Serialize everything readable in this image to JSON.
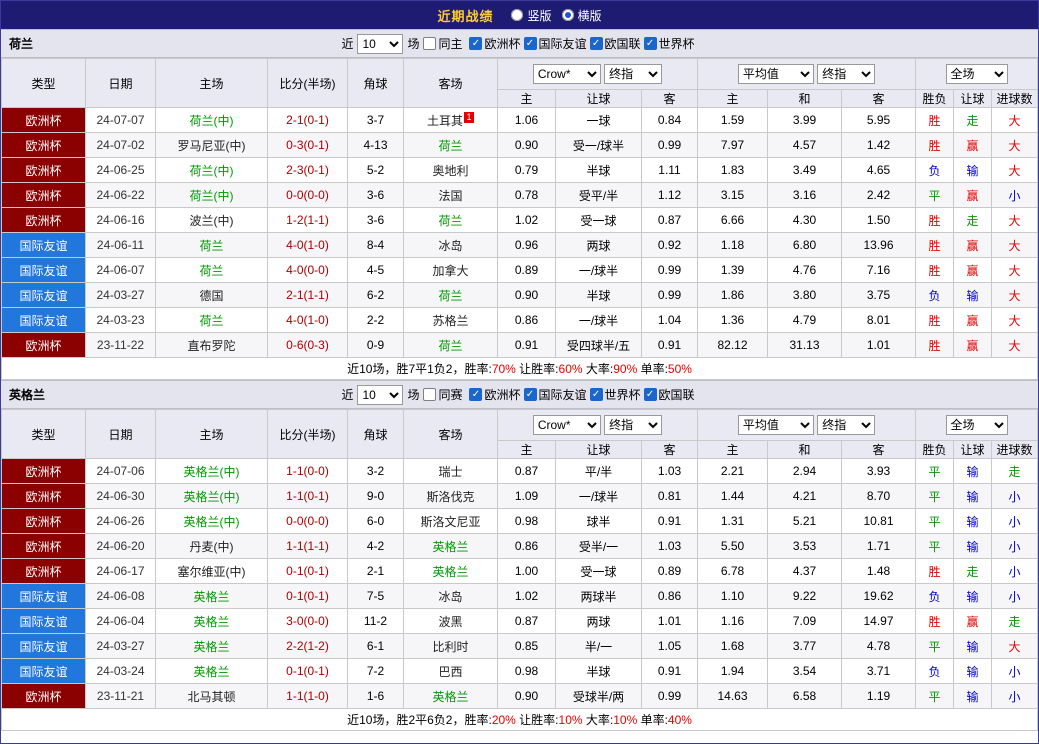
{
  "topbar": {
    "title": "近期战绩",
    "orientations": [
      {
        "label": "竖版",
        "selected": false
      },
      {
        "label": "横版",
        "selected": true
      }
    ]
  },
  "labels": {
    "recent_prefix": "近",
    "recent_suffix": "场"
  },
  "columns": {
    "main": [
      "类型",
      "日期",
      "主场",
      "比分(半场)",
      "角球",
      "客场"
    ],
    "sub": [
      "主",
      "让球",
      "客",
      "主",
      "和",
      "客",
      "胜负",
      "让球",
      "进球数"
    ],
    "odds_selects": {
      "bookmaker": "Crow*",
      "final1": "终指",
      "average": "平均值",
      "final2": "终指",
      "fulltime": "全场"
    }
  },
  "colors": {
    "team_highlight": "#009900",
    "score": "#aa0000",
    "red_card": "#e60000",
    "summary_highlight": "#e60000"
  },
  "type_colors": {
    "欧洲杯": "#8b0000",
    "国际友谊": "#2277dd",
    "世界杯": "#8b0000",
    "欧国联": "#8b0000"
  },
  "result_colors": {
    "胜": "#e60000",
    "平": "#009900",
    "负": "#0000cc",
    "赢": "#e60000",
    "走": "#009900",
    "输": "#0000cc",
    "大": "#e60000",
    "小": "#0000cc"
  },
  "sections": [
    {
      "team": "荷兰",
      "recent_count": "10",
      "same_filter": {
        "label": "同主",
        "checked": false
      },
      "league_filters": [
        {
          "label": "欧洲杯",
          "checked": true
        },
        {
          "label": "国际友谊",
          "checked": true
        },
        {
          "label": "欧国联",
          "checked": true
        },
        {
          "label": "世界杯",
          "checked": true
        }
      ],
      "rows": [
        {
          "type": "欧洲杯",
          "date": "24-07-07",
          "home": "荷兰(中)",
          "home_hl": true,
          "score": "2-1(0-1)",
          "corners": "3-7",
          "away": "土耳其",
          "away_hl": false,
          "away_red_card": "1",
          "home_odds": "1.06",
          "handicap": "一球",
          "away_odds": "0.84",
          "avg_home": "1.59",
          "avg_draw": "3.99",
          "avg_away": "5.95",
          "result": "胜",
          "handicap_result": "走",
          "goals": "大"
        },
        {
          "type": "欧洲杯",
          "date": "24-07-02",
          "home": "罗马尼亚(中)",
          "home_hl": false,
          "score": "0-3(0-1)",
          "corners": "4-13",
          "away": "荷兰",
          "away_hl": true,
          "home_odds": "0.90",
          "handicap": "受一/球半",
          "away_odds": "0.99",
          "avg_home": "7.97",
          "avg_draw": "4.57",
          "avg_away": "1.42",
          "result": "胜",
          "handicap_result": "赢",
          "goals": "大"
        },
        {
          "type": "欧洲杯",
          "date": "24-06-25",
          "home": "荷兰(中)",
          "home_hl": true,
          "score": "2-3(0-1)",
          "corners": "5-2",
          "away": "奥地利",
          "away_hl": false,
          "home_odds": "0.79",
          "handicap": "半球",
          "away_odds": "1.11",
          "avg_home": "1.83",
          "avg_draw": "3.49",
          "avg_away": "4.65",
          "result": "负",
          "handicap_result": "输",
          "goals": "大"
        },
        {
          "type": "欧洲杯",
          "date": "24-06-22",
          "home": "荷兰(中)",
          "home_hl": true,
          "score": "0-0(0-0)",
          "corners": "3-6",
          "away": "法国",
          "away_hl": false,
          "home_odds": "0.78",
          "handicap": "受平/半",
          "away_odds": "1.12",
          "avg_home": "3.15",
          "avg_draw": "3.16",
          "avg_away": "2.42",
          "result": "平",
          "handicap_result": "赢",
          "goals": "小"
        },
        {
          "type": "欧洲杯",
          "date": "24-06-16",
          "home": "波兰(中)",
          "home_hl": false,
          "score": "1-2(1-1)",
          "corners": "3-6",
          "away": "荷兰",
          "away_hl": true,
          "home_odds": "1.02",
          "handicap": "受一球",
          "away_odds": "0.87",
          "avg_home": "6.66",
          "avg_draw": "4.30",
          "avg_away": "1.50",
          "result": "胜",
          "handicap_result": "走",
          "goals": "大"
        },
        {
          "type": "国际友谊",
          "date": "24-06-11",
          "home": "荷兰",
          "home_hl": true,
          "score": "4-0(1-0)",
          "corners": "8-4",
          "away": "冰岛",
          "away_hl": false,
          "home_odds": "0.96",
          "handicap": "两球",
          "away_odds": "0.92",
          "avg_home": "1.18",
          "avg_draw": "6.80",
          "avg_away": "13.96",
          "result": "胜",
          "handicap_result": "赢",
          "goals": "大"
        },
        {
          "type": "国际友谊",
          "date": "24-06-07",
          "home": "荷兰",
          "home_hl": true,
          "score": "4-0(0-0)",
          "corners": "4-5",
          "away": "加拿大",
          "away_hl": false,
          "home_odds": "0.89",
          "handicap": "一/球半",
          "away_odds": "0.99",
          "avg_home": "1.39",
          "avg_draw": "4.76",
          "avg_away": "7.16",
          "result": "胜",
          "handicap_result": "赢",
          "goals": "大"
        },
        {
          "type": "国际友谊",
          "date": "24-03-27",
          "home": "德国",
          "home_hl": false,
          "score": "2-1(1-1)",
          "corners": "6-2",
          "away": "荷兰",
          "away_hl": true,
          "home_odds": "0.90",
          "handicap": "半球",
          "away_odds": "0.99",
          "avg_home": "1.86",
          "avg_draw": "3.80",
          "avg_away": "3.75",
          "result": "负",
          "handicap_result": "输",
          "goals": "大"
        },
        {
          "type": "国际友谊",
          "date": "24-03-23",
          "home": "荷兰",
          "home_hl": true,
          "score": "4-0(1-0)",
          "corners": "2-2",
          "away": "苏格兰",
          "away_hl": false,
          "home_odds": "0.86",
          "handicap": "一/球半",
          "away_odds": "1.04",
          "avg_home": "1.36",
          "avg_draw": "4.79",
          "avg_away": "8.01",
          "result": "胜",
          "handicap_result": "赢",
          "goals": "大"
        },
        {
          "type": "欧洲杯",
          "date": "23-11-22",
          "home": "直布罗陀",
          "home_hl": false,
          "score": "0-6(0-3)",
          "corners": "0-9",
          "away": "荷兰",
          "away_hl": true,
          "home_odds": "0.91",
          "handicap": "受四球半/五",
          "away_odds": "0.91",
          "avg_home": "82.12",
          "avg_draw": "31.13",
          "avg_away": "1.01",
          "result": "胜",
          "handicap_result": "赢",
          "goals": "大"
        }
      ],
      "summary": [
        {
          "text": "近10场，胜7平1负2，胜率:",
          "highlight": false
        },
        {
          "text": "70%",
          "highlight": true
        },
        {
          "text": " 让胜率:",
          "highlight": false
        },
        {
          "text": "60%",
          "highlight": true
        },
        {
          "text": " 大率:",
          "highlight": false
        },
        {
          "text": "90%",
          "highlight": true
        },
        {
          "text": " 单率:",
          "highlight": false
        },
        {
          "text": "50%",
          "highlight": true
        }
      ]
    },
    {
      "team": "英格兰",
      "recent_count": "10",
      "same_filter": {
        "label": "同赛",
        "checked": false
      },
      "league_filters": [
        {
          "label": "欧洲杯",
          "checked": true
        },
        {
          "label": "国际友谊",
          "checked": true
        },
        {
          "label": "世界杯",
          "checked": true
        },
        {
          "label": "欧国联",
          "checked": true
        }
      ],
      "rows": [
        {
          "type": "欧洲杯",
          "date": "24-07-06",
          "home": "英格兰(中)",
          "home_hl": true,
          "score": "1-1(0-0)",
          "corners": "3-2",
          "away": "瑞士",
          "away_hl": false,
          "home_odds": "0.87",
          "handicap": "平/半",
          "away_odds": "1.03",
          "avg_home": "2.21",
          "avg_draw": "2.94",
          "avg_away": "3.93",
          "result": "平",
          "handicap_result": "输",
          "goals": "走"
        },
        {
          "type": "欧洲杯",
          "date": "24-06-30",
          "home": "英格兰(中)",
          "home_hl": true,
          "score": "1-1(0-1)",
          "corners": "9-0",
          "away": "斯洛伐克",
          "away_hl": false,
          "home_odds": "1.09",
          "handicap": "一/球半",
          "away_odds": "0.81",
          "avg_home": "1.44",
          "avg_draw": "4.21",
          "avg_away": "8.70",
          "result": "平",
          "handicap_result": "输",
          "goals": "小"
        },
        {
          "type": "欧洲杯",
          "date": "24-06-26",
          "home": "英格兰(中)",
          "home_hl": true,
          "score": "0-0(0-0)",
          "corners": "6-0",
          "away": "斯洛文尼亚",
          "away_hl": false,
          "home_odds": "0.98",
          "handicap": "球半",
          "away_odds": "0.91",
          "avg_home": "1.31",
          "avg_draw": "5.21",
          "avg_away": "10.81",
          "result": "平",
          "handicap_result": "输",
          "goals": "小"
        },
        {
          "type": "欧洲杯",
          "date": "24-06-20",
          "home": "丹麦(中)",
          "home_hl": false,
          "score": "1-1(1-1)",
          "corners": "4-2",
          "away": "英格兰",
          "away_hl": true,
          "home_odds": "0.86",
          "handicap": "受半/一",
          "away_odds": "1.03",
          "avg_home": "5.50",
          "avg_draw": "3.53",
          "avg_away": "1.71",
          "result": "平",
          "handicap_result": "输",
          "goals": "小"
        },
        {
          "type": "欧洲杯",
          "date": "24-06-17",
          "home": "塞尔维亚(中)",
          "home_hl": false,
          "score": "0-1(0-1)",
          "corners": "2-1",
          "away": "英格兰",
          "away_hl": true,
          "home_odds": "1.00",
          "handicap": "受一球",
          "away_odds": "0.89",
          "avg_home": "6.78",
          "avg_draw": "4.37",
          "avg_away": "1.48",
          "result": "胜",
          "handicap_result": "走",
          "goals": "小"
        },
        {
          "type": "国际友谊",
          "date": "24-06-08",
          "home": "英格兰",
          "home_hl": true,
          "score": "0-1(0-1)",
          "corners": "7-5",
          "away": "冰岛",
          "away_hl": false,
          "home_odds": "1.02",
          "handicap": "两球半",
          "away_odds": "0.86",
          "avg_home": "1.10",
          "avg_draw": "9.22",
          "avg_away": "19.62",
          "result": "负",
          "handicap_result": "输",
          "goals": "小"
        },
        {
          "type": "国际友谊",
          "date": "24-06-04",
          "home": "英格兰",
          "home_hl": true,
          "score": "3-0(0-0)",
          "corners": "11-2",
          "away": "波黑",
          "away_hl": false,
          "home_odds": "0.87",
          "handicap": "两球",
          "away_odds": "1.01",
          "avg_home": "1.16",
          "avg_draw": "7.09",
          "avg_away": "14.97",
          "result": "胜",
          "handicap_result": "赢",
          "goals": "走"
        },
        {
          "type": "国际友谊",
          "date": "24-03-27",
          "home": "英格兰",
          "home_hl": true,
          "score": "2-2(1-2)",
          "corners": "6-1",
          "away": "比利时",
          "away_hl": false,
          "home_odds": "0.85",
          "handicap": "半/一",
          "away_odds": "1.05",
          "avg_home": "1.68",
          "avg_draw": "3.77",
          "avg_away": "4.78",
          "result": "平",
          "handicap_result": "输",
          "goals": "大"
        },
        {
          "type": "国际友谊",
          "date": "24-03-24",
          "home": "英格兰",
          "home_hl": true,
          "score": "0-1(0-1)",
          "corners": "7-2",
          "away": "巴西",
          "away_hl": false,
          "home_odds": "0.98",
          "handicap": "半球",
          "away_odds": "0.91",
          "avg_home": "1.94",
          "avg_draw": "3.54",
          "avg_away": "3.71",
          "result": "负",
          "handicap_result": "输",
          "goals": "小"
        },
        {
          "type": "欧洲杯",
          "date": "23-11-21",
          "home": "北马其顿",
          "home_hl": false,
          "score": "1-1(1-0)",
          "corners": "1-6",
          "away": "英格兰",
          "away_hl": true,
          "home_odds": "0.90",
          "handicap": "受球半/两",
          "away_odds": "0.99",
          "avg_home": "14.63",
          "avg_draw": "6.58",
          "avg_away": "1.19",
          "result": "平",
          "handicap_result": "输",
          "goals": "小"
        }
      ],
      "summary": [
        {
          "text": "近10场，胜2平6负2，胜率:",
          "highlight": false
        },
        {
          "text": "20%",
          "highlight": true
        },
        {
          "text": " 让胜率:",
          "highlight": false
        },
        {
          "text": "10%",
          "highlight": true
        },
        {
          "text": " 大率:",
          "highlight": false
        },
        {
          "text": "10%",
          "highlight": true
        },
        {
          "text": " 单率:",
          "highlight": false
        },
        {
          "text": "40%",
          "highlight": true
        }
      ]
    }
  ]
}
